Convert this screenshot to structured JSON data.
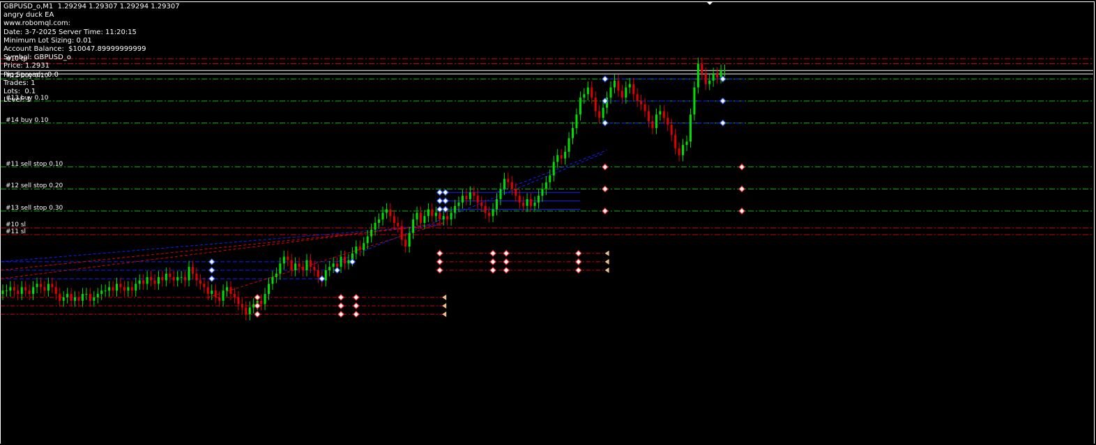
{
  "info_panel": {
    "lines": [
      "GBPUSD_o,M1  1.29294 1.29307 1.29294 1.29307",
      "angry duck EA",
      "www.robomql.com:",
      "Date: 3-7-2025 Server Time: 11:20:15",
      "Minimum Lot Sizing: 0.01",
      "Account Balance:  $10047.89999999999",
      "Symbol: GBPUSD_o",
      "Price: 1.2931",
      "Pip Spread:  0.0",
      "Trades: 1",
      "Lots:  0.1",
      "Level: 1"
    ]
  },
  "level_labels": [
    {
      "text": "#10 tp",
      "level": 1.2932,
      "offset": -3
    },
    {
      "text": "#12 buy 0.10",
      "level": 1.29275
    },
    {
      "text": "#13 buy 0.10",
      "level": 1.2921
    },
    {
      "text": "#14 buy 0.10",
      "level": 1.29145
    },
    {
      "text": "#11 sell stop 0.10",
      "level": 1.29015
    },
    {
      "text": "#12 sell stop 0.20",
      "level": 1.2895
    },
    {
      "text": "#13 sell stop 0.30",
      "level": 1.28885
    },
    {
      "text": "#10 sl",
      "level": 1.28835
    },
    {
      "text": "#11 sl",
      "level": 1.28815
    }
  ],
  "colors": {
    "bull": "#00e000",
    "bear": "#e00000",
    "buy_level": "#00c000",
    "sell_level": "#e00000",
    "blue_line": "#1020ff",
    "price_line": "#ffffff",
    "marker_buy": "#3060ff",
    "marker_sell": "#ff3030",
    "marker_close": "#f0c080"
  },
  "chart_data": {
    "type": "candlestick",
    "symbol": "GBPUSD_o",
    "timeframe": "M1",
    "ylim": [
      1.282,
      1.295
    ],
    "price_lines": [
      1.293,
      1.2929
    ],
    "levels": [
      {
        "price": 1.29335,
        "color": "red",
        "style": "dashdot"
      },
      {
        "price": 1.2932,
        "color": "red",
        "style": "dashdot"
      },
      {
        "price": 1.29275,
        "color": "green",
        "style": "dashdot"
      },
      {
        "price": 1.2921,
        "color": "green",
        "style": "dashdot"
      },
      {
        "price": 1.29145,
        "color": "green",
        "style": "dashdot"
      },
      {
        "price": 1.29015,
        "color": "green",
        "style": "dashdot"
      },
      {
        "price": 1.2895,
        "color": "green",
        "style": "dashdot"
      },
      {
        "price": 1.28885,
        "color": "green",
        "style": "dashdot"
      },
      {
        "price": 1.28835,
        "color": "red",
        "style": "dashdot"
      },
      {
        "price": 1.28815,
        "color": "red",
        "style": "dashdot"
      }
    ],
    "closes": [
      1.2865,
      1.2865,
      1.2866,
      1.2865,
      1.2864,
      1.2866,
      1.2865,
      1.2864,
      1.2866,
      1.2867,
      1.2866,
      1.2865,
      1.2867,
      1.2866,
      1.2864,
      1.2862,
      1.2863,
      1.2864,
      1.2862,
      1.2863,
      1.2862,
      1.2864,
      1.2864,
      1.2862,
      1.2863,
      1.2864,
      1.2865,
      1.2865,
      1.2866,
      1.2865,
      1.2867,
      1.2866,
      1.2865,
      1.2866,
      1.2865,
      1.2867,
      1.2868,
      1.2867,
      1.2869,
      1.2868,
      1.2867,
      1.2869,
      1.2868,
      1.287,
      1.2869,
      1.2868,
      1.2869,
      1.2869,
      1.2868,
      1.2872,
      1.287,
      1.2868,
      1.2867,
      1.2866,
      1.2864,
      1.2865,
      1.2863,
      1.2862,
      1.2865,
      1.2866,
      1.2864,
      1.2863,
      1.2861,
      1.286,
      1.2858,
      1.286,
      1.2861,
      1.2862,
      1.2861,
      1.2864,
      1.2867,
      1.2869,
      1.287,
      1.2873,
      1.2875,
      1.2874,
      1.2871,
      1.2873,
      1.2872,
      1.2871,
      1.2874,
      1.2872,
      1.2871,
      1.2869,
      1.2868,
      1.2871,
      1.2872,
      1.2873,
      1.2872,
      1.2875,
      1.2873,
      1.2874,
      1.2876,
      1.2878,
      1.2877,
      1.2879,
      1.2881,
      1.2883,
      1.2885,
      1.2886,
      1.2888,
      1.2889,
      1.2887,
      1.2885,
      1.2884,
      1.288,
      1.2878,
      1.2882,
      1.2886,
      1.2888,
      1.2885,
      1.2887,
      1.2889,
      1.2887,
      1.2888,
      1.2886,
      1.2887,
      1.2886,
      1.2888,
      1.289,
      1.2891,
      1.2893,
      1.2892,
      1.2894,
      1.2893,
      1.2891,
      1.289,
      1.2888,
      1.2887,
      1.2889,
      1.2892,
      1.2895,
      1.2898,
      1.2897,
      1.2895,
      1.2893,
      1.2891,
      1.289,
      1.2892,
      1.289,
      1.2891,
      1.2893,
      1.2895,
      1.2897,
      1.2899,
      1.2903,
      1.2905,
      1.2904,
      1.2906,
      1.291,
      1.2913,
      1.2917,
      1.2922,
      1.2923,
      1.2925,
      1.2922,
      1.2918,
      1.2916,
      1.2919,
      1.2922,
      1.2925,
      1.2927,
      1.2924,
      1.2922,
      1.2925,
      1.2926,
      1.2923,
      1.2921,
      1.292,
      1.2918,
      1.2915,
      1.2913,
      1.2917,
      1.2918,
      1.2916,
      1.2914,
      1.2911,
      1.2907,
      1.2905,
      1.2908,
      1.2909,
      1.2917,
      1.2925,
      1.2932,
      1.2929,
      1.2926,
      1.2927,
      1.2929,
      1.2928,
      1.293,
      1.293
    ]
  }
}
